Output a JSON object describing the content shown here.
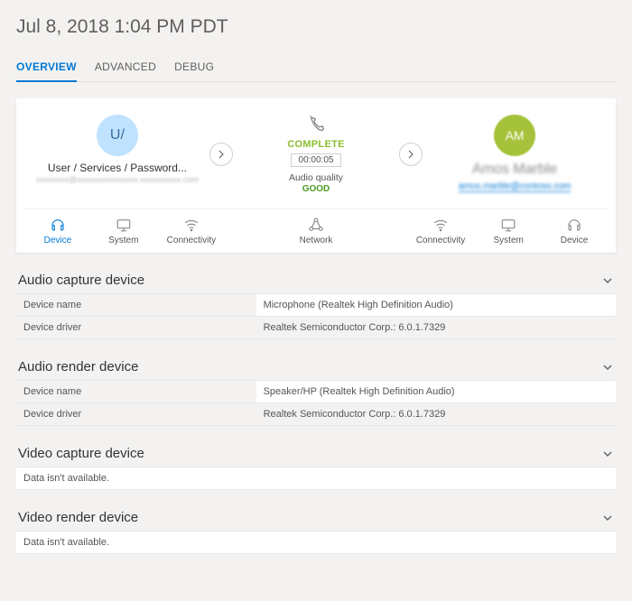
{
  "header": {
    "timestamp": "Jul 8, 2018 1:04 PM PDT"
  },
  "tabs": {
    "overview": "OVERVIEW",
    "advanced": "ADVANCED",
    "debug": "DEBUG"
  },
  "call": {
    "caller": {
      "avatar_initials": "U/",
      "name": "User / Services / Password...",
      "sub": "xxxxxxxx@xxxxxxxxxxxxxxx.xxxxxxxxxx.com"
    },
    "status": "COMPLETE",
    "duration": "00:00:05",
    "audio_quality_label": "Audio quality",
    "audio_quality_value": "GOOD",
    "callee": {
      "avatar_initials": "AM",
      "name": "Amos Marble",
      "link": "amos.marble@contoso.com"
    }
  },
  "categories": {
    "left": [
      {
        "id": "device",
        "label": "Device",
        "active": true
      },
      {
        "id": "system",
        "label": "System",
        "active": false
      },
      {
        "id": "connectivity",
        "label": "Connectivity",
        "active": false
      }
    ],
    "center": [
      {
        "id": "network",
        "label": "Network",
        "active": false
      }
    ],
    "right": [
      {
        "id": "connectivity",
        "label": "Connectivity",
        "active": false
      },
      {
        "id": "system",
        "label": "System",
        "active": false
      },
      {
        "id": "device",
        "label": "Device",
        "active": false
      }
    ]
  },
  "sections": [
    {
      "title": "Audio capture device",
      "rows": [
        {
          "k": "Device name",
          "v": "Microphone (Realtek High Definition Audio)"
        },
        {
          "k": "Device driver",
          "v": "Realtek Semiconductor Corp.: 6.0.1.7329"
        }
      ]
    },
    {
      "title": "Audio render device",
      "rows": [
        {
          "k": "Device name",
          "v": "Speaker/HP (Realtek High Definition Audio)"
        },
        {
          "k": "Device driver",
          "v": "Realtek Semiconductor Corp.: 6.0.1.7329"
        }
      ]
    },
    {
      "title": "Video capture device",
      "empty": "Data isn't available."
    },
    {
      "title": "Video render device",
      "empty": "Data isn't available."
    }
  ]
}
